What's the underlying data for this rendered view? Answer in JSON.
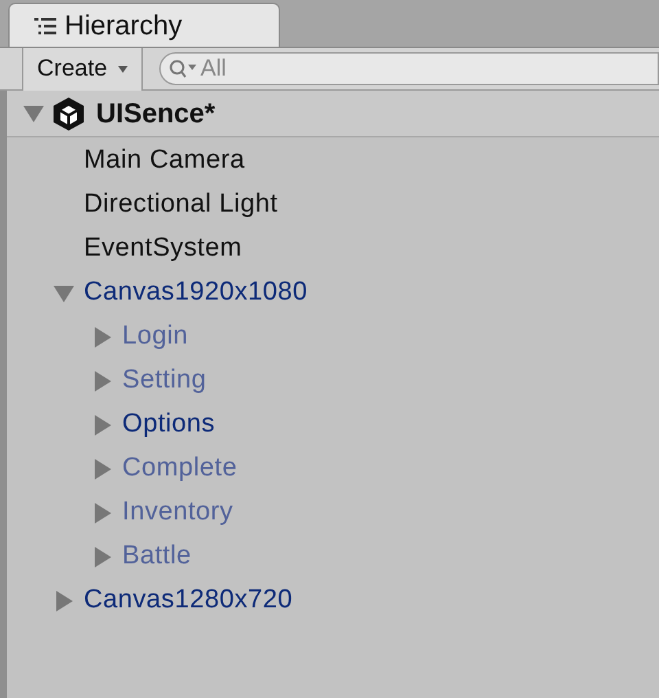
{
  "tab": {
    "title": "Hierarchy"
  },
  "toolbar": {
    "create_label": "Create",
    "search": {
      "value": "All"
    }
  },
  "scene": {
    "name": "UISence*",
    "expanded": true,
    "children": [
      {
        "name": "Main Camera",
        "kind": "object",
        "active": true
      },
      {
        "name": "Directional Light",
        "kind": "object",
        "active": true
      },
      {
        "name": "EventSystem",
        "kind": "object",
        "active": true
      },
      {
        "name": "Canvas1920x1080",
        "kind": "prefab",
        "active": true,
        "expanded": true,
        "children": [
          {
            "name": "Login",
            "kind": "prefab",
            "active": false,
            "expanded": false
          },
          {
            "name": "Setting",
            "kind": "prefab",
            "active": false,
            "expanded": false
          },
          {
            "name": "Options",
            "kind": "prefab",
            "active": true,
            "expanded": false
          },
          {
            "name": "Complete",
            "kind": "prefab",
            "active": false,
            "expanded": false
          },
          {
            "name": "Inventory",
            "kind": "prefab",
            "active": false,
            "expanded": false
          },
          {
            "name": "Battle",
            "kind": "prefab",
            "active": false,
            "expanded": false
          }
        ]
      },
      {
        "name": "Canvas1280x720",
        "kind": "prefab",
        "active": true,
        "expanded": false
      }
    ]
  }
}
